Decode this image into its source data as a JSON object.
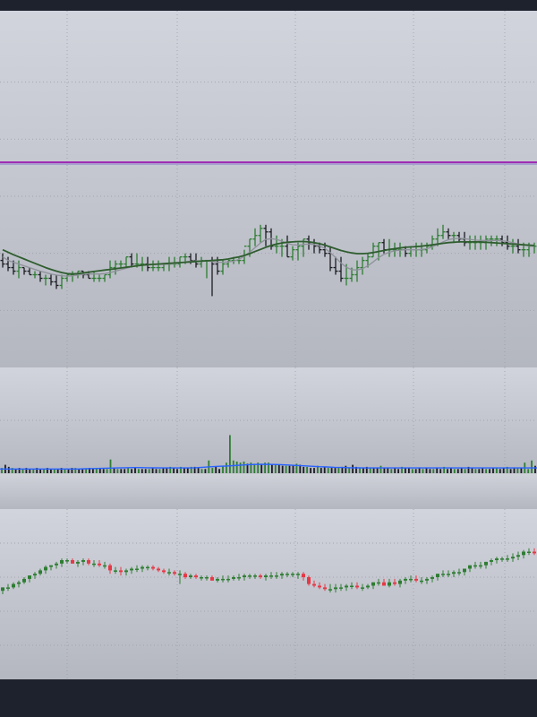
{
  "theme": {
    "frame": "#1e222d",
    "grid": "#9a9da6",
    "bar_up": "#2e7d32",
    "bar_down": "#1b1d22",
    "ma_fast": "#8d9199",
    "ma_slow": "#2f5d2f",
    "level_line": "#9c27b0",
    "volume_line": "#2962ff",
    "candle_up": "#2e7d32",
    "candle_down": "#e53946"
  },
  "chart_data": [
    {
      "type": "ohlc",
      "pane": "price",
      "grid": true,
      "ylim": [
        0,
        100
      ],
      "level_line": 57.5,
      "x_gridlines": [
        12.5,
        33,
        55,
        77,
        94
      ],
      "y_gridlines": [
        16,
        32,
        48,
        64,
        80
      ],
      "open": [
        30,
        29,
        28,
        27,
        28,
        27,
        26,
        26,
        25,
        25,
        24,
        23,
        25,
        26,
        26,
        27,
        26,
        25,
        25,
        25,
        26,
        28,
        29,
        29,
        31,
        29,
        29,
        29,
        28,
        28,
        28,
        29,
        29,
        29,
        31,
        31,
        30,
        29,
        30,
        30,
        29,
        27,
        29,
        30,
        30,
        30,
        34,
        36,
        37,
        39,
        38,
        34,
        34,
        34,
        31,
        33,
        34,
        36,
        35,
        34,
        33,
        32,
        28,
        27,
        25,
        25,
        26,
        28,
        30,
        31,
        34,
        35,
        33,
        33,
        33,
        33,
        32,
        33,
        33,
        33,
        34,
        36,
        37,
        38,
        37,
        37,
        36,
        35,
        35,
        35,
        35,
        36,
        36,
        36,
        35,
        34,
        34,
        33,
        33,
        34
      ],
      "high": [
        32,
        31,
        30,
        30,
        28,
        28,
        27,
        27,
        26,
        26,
        26,
        26,
        26,
        27,
        27,
        27,
        27,
        27,
        26,
        26,
        30,
        30,
        30,
        31,
        32,
        32,
        31,
        31,
        30,
        30,
        29,
        31,
        31,
        31,
        32,
        32,
        32,
        31,
        30,
        31,
        31,
        30,
        30,
        31,
        31,
        33,
        36,
        39,
        40,
        40,
        39,
        37,
        36,
        37,
        34,
        35,
        36,
        37,
        36,
        35,
        35,
        34,
        31,
        31,
        29,
        28,
        30,
        31,
        32,
        35,
        35,
        36,
        36,
        35,
        35,
        34,
        34,
        35,
        35,
        35,
        37,
        39,
        40,
        39,
        38,
        38,
        38,
        37,
        37,
        37,
        37,
        37,
        37,
        37,
        37,
        36,
        36,
        35,
        35,
        35
      ],
      "low": [
        28,
        27,
        26,
        25,
        26,
        26,
        25,
        24,
        23,
        23,
        22,
        22,
        24,
        24,
        25,
        25,
        25,
        24,
        24,
        24,
        25,
        26,
        28,
        28,
        28,
        28,
        27,
        27,
        27,
        27,
        27,
        27,
        28,
        28,
        29,
        29,
        28,
        28,
        25,
        20,
        26,
        26,
        28,
        29,
        29,
        29,
        31,
        34,
        35,
        34,
        33,
        32,
        31,
        31,
        30,
        30,
        31,
        33,
        32,
        32,
        31,
        27,
        26,
        24,
        23,
        24,
        24,
        26,
        28,
        31,
        30,
        32,
        31,
        31,
        31,
        31,
        31,
        31,
        31,
        32,
        33,
        34,
        36,
        36,
        35,
        35,
        34,
        33,
        33,
        33,
        33,
        34,
        34,
        34,
        33,
        32,
        32,
        31,
        31,
        32
      ],
      "close": [
        29,
        28,
        27,
        28,
        27,
        26,
        26,
        25,
        25,
        24,
        23,
        25,
        26,
        26,
        27,
        26,
        25,
        25,
        25,
        26,
        28,
        29,
        29,
        31,
        29,
        29,
        29,
        28,
        28,
        28,
        29,
        29,
        29,
        31,
        31,
        30,
        29,
        30,
        30,
        29,
        27,
        29,
        30,
        30,
        30,
        34,
        36,
        37,
        39,
        38,
        34,
        34,
        34,
        31,
        33,
        34,
        36,
        35,
        34,
        33,
        32,
        28,
        27,
        25,
        25,
        26,
        28,
        30,
        31,
        34,
        35,
        33,
        33,
        33,
        33,
        32,
        33,
        33,
        33,
        34,
        36,
        37,
        38,
        37,
        37,
        36,
        35,
        35,
        35,
        35,
        36,
        36,
        36,
        35,
        34,
        34,
        33,
        33,
        34,
        34
      ],
      "ma_fast": [
        31,
        30,
        29.5,
        29,
        28.5,
        28,
        27.5,
        27,
        26.6,
        26.2,
        25.9,
        25.7,
        25.6,
        25.7,
        25.9,
        26.1,
        26.2,
        26.2,
        26.2,
        26.3,
        26.6,
        27,
        27.4,
        27.8,
        28.2,
        28.5,
        28.7,
        28.9,
        28.9,
        28.9,
        28.9,
        29,
        29.1,
        29.3,
        29.6,
        29.8,
        29.9,
        29.9,
        29.9,
        29.7,
        29.5,
        29.5,
        29.6,
        29.8,
        30.3,
        31.2,
        32.3,
        33.6,
        34.9,
        35.9,
        36.1,
        35.9,
        35.4,
        34.8,
        34.4,
        34.3,
        34.5,
        34.6,
        34.5,
        34.1,
        33.4,
        32.2,
        30.8,
        29.3,
        28.1,
        27.4,
        27.3,
        27.7,
        28.5,
        29.6,
        30.8,
        31.7,
        32.3,
        32.7,
        32.9,
        33,
        33,
        33,
        33.1,
        33.3,
        33.8,
        34.5,
        35.2,
        35.8,
        36.1,
        36.2,
        36.1,
        35.9,
        35.7,
        35.6,
        35.6,
        35.6,
        35.6,
        35.5,
        35.3,
        35,
        34.6,
        34.3,
        34.1,
        34
      ],
      "ma_slow": [
        33,
        32.3,
        31.6,
        31,
        30.4,
        29.8,
        29.2,
        28.6,
        28,
        27.5,
        27,
        26.6,
        26.3,
        26.2,
        26.3,
        26.5,
        26.7,
        26.9,
        27.1,
        27.3,
        27.5,
        27.7,
        27.9,
        28.1,
        28.3,
        28.5,
        28.7,
        28.8,
        28.9,
        29,
        29.1,
        29.2,
        29.3,
        29.4,
        29.5,
        29.6,
        29.7,
        29.8,
        29.9,
        30,
        30.1,
        30.2,
        30.4,
        30.7,
        31,
        31.4,
        31.9,
        32.5,
        33.1,
        33.7,
        34.2,
        34.6,
        34.9,
        35.1,
        35.2,
        35.3,
        35.3,
        35.2,
        35,
        34.7,
        34.3,
        33.8,
        33.3,
        32.8,
        32.4,
        32.1,
        31.9,
        31.9,
        32,
        32.2,
        32.5,
        32.8,
        33.1,
        33.3,
        33.5,
        33.7,
        33.8,
        33.9,
        34,
        34.2,
        34.4,
        34.6,
        34.8,
        35,
        35.1,
        35.2,
        35.2,
        35.2,
        35.2,
        35.2,
        35.1,
        35,
        34.9,
        34.8,
        34.7,
        34.6,
        34.5,
        34.4,
        34.3,
        34.2
      ]
    },
    {
      "type": "bar",
      "pane": "volume",
      "grid": true,
      "ylim": [
        0,
        100
      ],
      "values": [
        5,
        8,
        6,
        5,
        4,
        5,
        4,
        5,
        4,
        4,
        5,
        4,
        4,
        5,
        4,
        4,
        4,
        5,
        4,
        4,
        5,
        5,
        4,
        4,
        4,
        5,
        4,
        5,
        5,
        4,
        4,
        13,
        5,
        4,
        4,
        4,
        5,
        4,
        5,
        4,
        4,
        4,
        4,
        5,
        4,
        4,
        5,
        5,
        6,
        5,
        4,
        6,
        5,
        5,
        6,
        6,
        5,
        4,
        4,
        12,
        5,
        6,
        4,
        7,
        10,
        36,
        12,
        11,
        10,
        11,
        9,
        10,
        9,
        10,
        9,
        10,
        10,
        8,
        8,
        8,
        7,
        7,
        7,
        8,
        9,
        8,
        6,
        6,
        5,
        5,
        7,
        5,
        6,
        5,
        5,
        5,
        5,
        6,
        7,
        5,
        8,
        6,
        5,
        5,
        6,
        5,
        5,
        5,
        7,
        5,
        5,
        4,
        5,
        4,
        6,
        5,
        5,
        4,
        4,
        5,
        4,
        5,
        4,
        4,
        5,
        4,
        6,
        4,
        5,
        4,
        4,
        5,
        4,
        6,
        5,
        4,
        4,
        5,
        4,
        4,
        5,
        5,
        4,
        5,
        6,
        4,
        5,
        5,
        5,
        10,
        4,
        12,
        7
      ],
      "ma": [
        4,
        4,
        4,
        4,
        4,
        4,
        4,
        4,
        4,
        4,
        4,
        4.2,
        4.4,
        4.6,
        4.8,
        5,
        5.2,
        5.3,
        5.3,
        5.2,
        5.1,
        5,
        5,
        5,
        5,
        5.2,
        5.6,
        6.1,
        6.5,
        6.8,
        7.2,
        7.7,
        8.1,
        8.3,
        8.4,
        8.3,
        8.1,
        7.8,
        7.4,
        7,
        6.6,
        6.2,
        5.9,
        5.6,
        5.4,
        5.2,
        5.1,
        5,
        5,
        5,
        5,
        5,
        5,
        5,
        5,
        5,
        5,
        5,
        5,
        5,
        5,
        5,
        5,
        5,
        5,
        5,
        5,
        5,
        5,
        5
      ]
    },
    {
      "type": "candlestick",
      "pane": "bottom",
      "grid": true,
      "ylim": [
        0,
        100
      ],
      "open": [
        52,
        54,
        54,
        56,
        57,
        59,
        61,
        62,
        64,
        66,
        67,
        68,
        70,
        70,
        68,
        69,
        70,
        68,
        68,
        67,
        67,
        64,
        64,
        63,
        64,
        65,
        65,
        66,
        66,
        65,
        64,
        63,
        63,
        62,
        62,
        60,
        61,
        60,
        60,
        60,
        58,
        59,
        59,
        59,
        60,
        60,
        61,
        61,
        61,
        60,
        61,
        61,
        61,
        62,
        62,
        62,
        62,
        60,
        56,
        55,
        54,
        53,
        53,
        54,
        54,
        55,
        55,
        54,
        54,
        55,
        57,
        57,
        55,
        57,
        56,
        58,
        59,
        59,
        58,
        58,
        59,
        60,
        62,
        62,
        62,
        63,
        63,
        65,
        67,
        67,
        67,
        69,
        70,
        71,
        71,
        71,
        72,
        73,
        75,
        75
      ],
      "high": [
        54,
        56,
        57,
        58,
        60,
        61,
        63,
        65,
        67,
        67,
        69,
        71,
        71,
        71,
        70,
        71,
        71,
        70,
        70,
        69,
        68,
        66,
        66,
        65,
        66,
        67,
        67,
        67,
        67,
        66,
        65,
        65,
        64,
        64,
        63,
        62,
        62,
        61,
        61,
        61,
        60,
        61,
        61,
        61,
        62,
        62,
        62,
        62,
        62,
        62,
        63,
        63,
        63,
        63,
        63,
        63,
        63,
        61,
        58,
        57,
        56,
        56,
        56,
        56,
        56,
        57,
        57,
        56,
        56,
        57,
        59,
        59,
        59,
        59,
        59,
        60,
        61,
        61,
        60,
        60,
        61,
        62,
        64,
        64,
        64,
        65,
        65,
        67,
        69,
        69,
        69,
        71,
        72,
        72,
        73,
        74,
        75,
        76,
        77,
        77
      ],
      "low": [
        50,
        52,
        53,
        54,
        56,
        57,
        59,
        61,
        62,
        64,
        65,
        66,
        68,
        68,
        66,
        67,
        67,
        66,
        66,
        65,
        62,
        62,
        61,
        61,
        62,
        63,
        63,
        64,
        64,
        63,
        62,
        61,
        61,
        56,
        59,
        59,
        59,
        58,
        58,
        58,
        57,
        57,
        57,
        58,
        58,
        58,
        59,
        59,
        59,
        58,
        59,
        59,
        59,
        60,
        60,
        59,
        58,
        55,
        54,
        53,
        52,
        51,
        51,
        52,
        52,
        53,
        53,
        52,
        53,
        53,
        55,
        55,
        54,
        55,
        54,
        56,
        57,
        57,
        56,
        56,
        57,
        58,
        60,
        60,
        60,
        61,
        61,
        63,
        65,
        65,
        65,
        67,
        68,
        69,
        69,
        69,
        70,
        71,
        73,
        73
      ],
      "close": [
        54,
        54,
        56,
        57,
        59,
        61,
        62,
        64,
        66,
        67,
        68,
        70,
        70,
        68,
        69,
        70,
        68,
        68,
        67,
        67,
        64,
        64,
        63,
        64,
        65,
        65,
        66,
        66,
        65,
        64,
        63,
        63,
        62,
        62,
        60,
        61,
        60,
        60,
        60,
        58,
        59,
        59,
        59,
        60,
        60,
        61,
        61,
        61,
        60,
        61,
        61,
        61,
        62,
        62,
        62,
        62,
        60,
        56,
        55,
        54,
        53,
        53,
        54,
        54,
        55,
        55,
        54,
        54,
        55,
        57,
        57,
        55,
        57,
        56,
        58,
        59,
        59,
        58,
        58,
        59,
        60,
        62,
        62,
        62,
        63,
        63,
        65,
        67,
        67,
        67,
        69,
        70,
        71,
        71,
        71,
        72,
        73,
        75,
        75,
        74
      ]
    }
  ]
}
